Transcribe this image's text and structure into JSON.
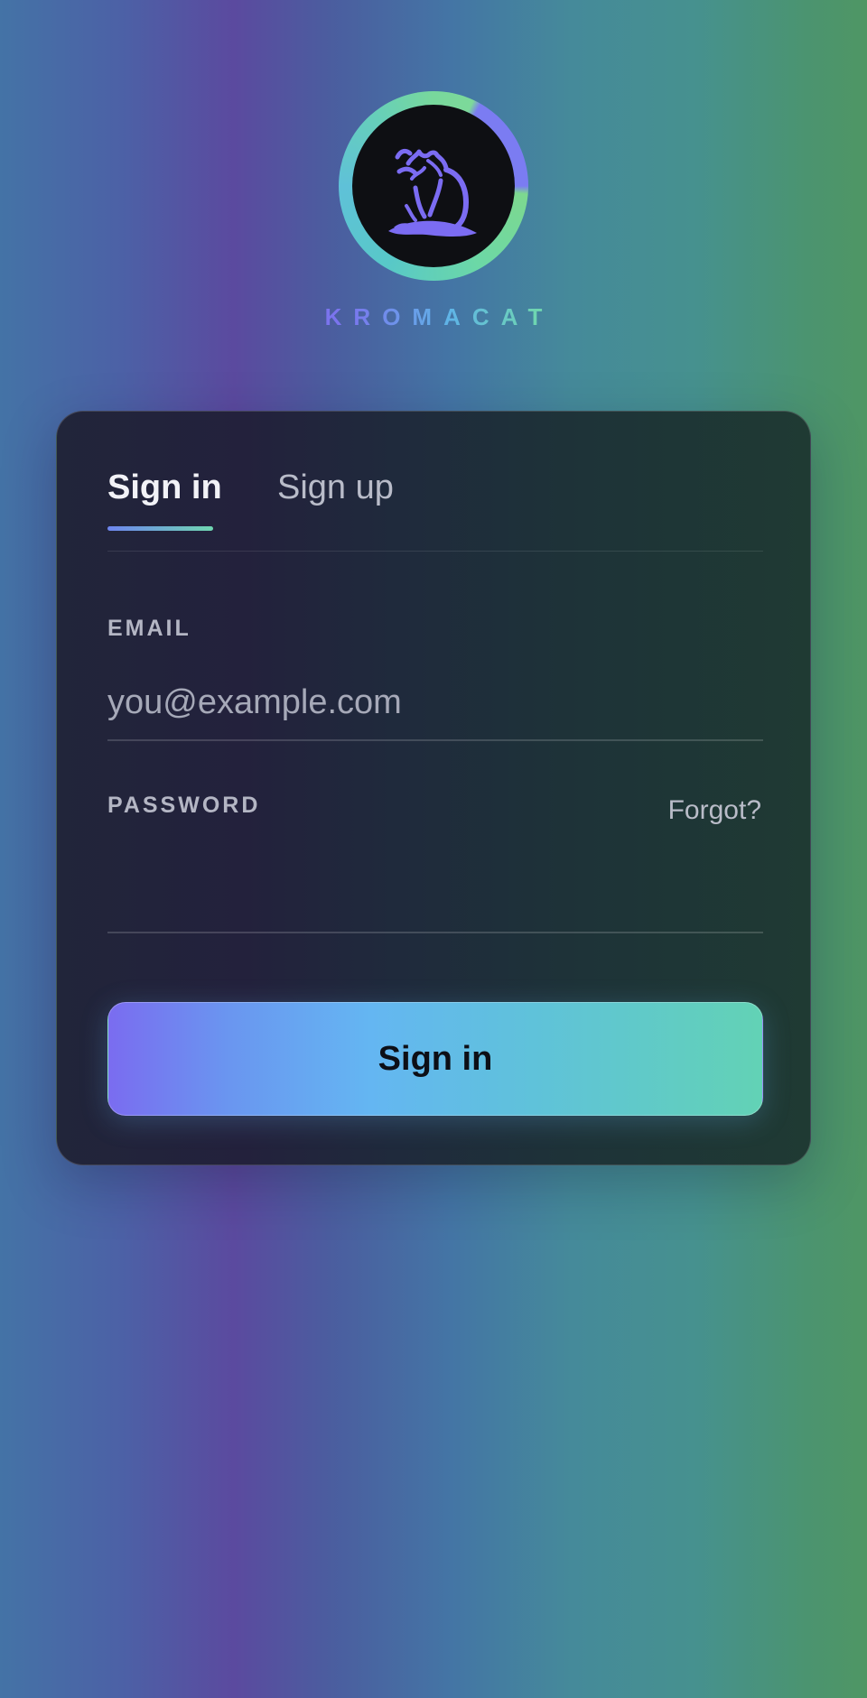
{
  "brand": {
    "logo_icon": "cat-icon",
    "name": "KROMACAT"
  },
  "tabs": [
    {
      "label": "Sign in",
      "active": true
    },
    {
      "label": "Sign up",
      "active": false
    }
  ],
  "form": {
    "email": {
      "label": "EMAIL",
      "placeholder": "you@example.com",
      "value": ""
    },
    "password": {
      "label": "PASSWORD",
      "value": "",
      "forgot_label": "Forgot?"
    },
    "submit_label": "Sign in"
  },
  "colors": {
    "accent_start": "#7a6cf0",
    "accent_mid": "#64b6f2",
    "accent_end": "#62d2b5",
    "card_bg": "#21283a"
  }
}
